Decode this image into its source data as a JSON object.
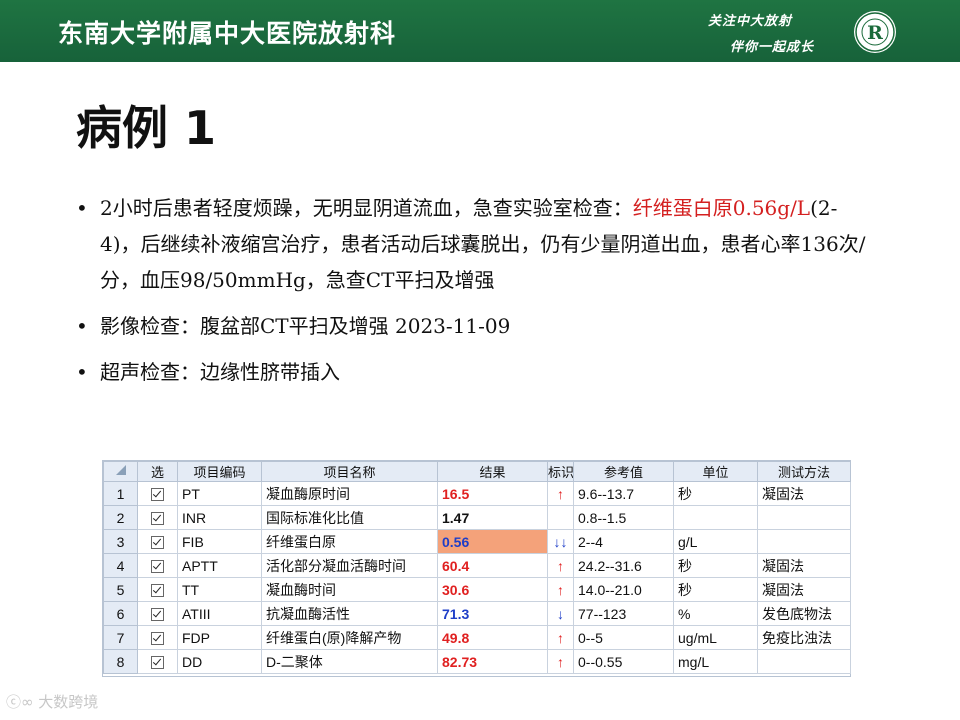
{
  "header": {
    "title": "东南大学附属中大医院放射科",
    "slogan_line1": "关注中大放射",
    "slogan_line2": "伴你一起成长",
    "logo_letter": "R",
    "color": "#1a6a3a"
  },
  "slide": {
    "title": "病例 1",
    "bullets": [
      {
        "parts": [
          {
            "text": "2小时后患者轻度烦躁，无明显阴道流血，急查实验室检查：",
            "color": "#111111"
          },
          {
            "text": "纤维蛋白原0.56g/L",
            "color": "#d42020"
          },
          {
            "text": "(2-4)，后继续补液缩宫治疗，患者活动后球囊脱出，仍有少量阴道出血，患者心率136次/分，血压98/50mmHg，急查CT平扫及增强",
            "color": "#111111"
          }
        ]
      },
      {
        "parts": [
          {
            "text": "影像检查：腹盆部CT平扫及增强 2023-11-09",
            "color": "#111111"
          }
        ]
      },
      {
        "parts": [
          {
            "text": "超声检查：边缘性脐带插入",
            "color": "#111111"
          }
        ]
      }
    ]
  },
  "lab_table": {
    "headers": [
      "",
      "选",
      "项目编码",
      "项目名称",
      "结果",
      "标识",
      "参考值",
      "单位",
      "测试方法"
    ],
    "rows": [
      {
        "idx": "1",
        "code": "PT",
        "name": "凝血酶原时间",
        "result": "16.5",
        "status": "high",
        "flag": "↑",
        "ref": "9.6--13.7",
        "unit": "秒",
        "method": "凝固法"
      },
      {
        "idx": "2",
        "code": "INR",
        "name": "国际标准化比值",
        "result": "1.47",
        "status": "normal",
        "flag": "",
        "ref": "0.8--1.5",
        "unit": "",
        "method": ""
      },
      {
        "idx": "3",
        "code": "FIB",
        "name": "纤维蛋白原",
        "result": "0.56",
        "status": "critical-low",
        "flag": "↓↓",
        "ref": "2--4",
        "unit": "g/L",
        "method": ""
      },
      {
        "idx": "4",
        "code": "APTT",
        "name": "活化部分凝血活酶时间",
        "result": "60.4",
        "status": "high",
        "flag": "↑",
        "ref": "24.2--31.6",
        "unit": "秒",
        "method": "凝固法"
      },
      {
        "idx": "5",
        "code": "TT",
        "name": "凝血酶时间",
        "result": "30.6",
        "status": "high",
        "flag": "↑",
        "ref": "14.0--21.0",
        "unit": "秒",
        "method": "凝固法"
      },
      {
        "idx": "6",
        "code": "ATIII",
        "name": "抗凝血酶活性",
        "result": "71.3",
        "status": "low",
        "flag": "↓",
        "ref": "77--123",
        "unit": "%",
        "method": "发色底物法"
      },
      {
        "idx": "7",
        "code": "FDP",
        "name": "纤维蛋白(原)降解产物",
        "result": "49.8",
        "status": "high",
        "flag": "↑",
        "ref": "0--5",
        "unit": "ug/mL",
        "method": "免疫比浊法"
      },
      {
        "idx": "8",
        "code": "DD",
        "name": "D-二聚体",
        "result": "82.73",
        "status": "high",
        "flag": "↑",
        "ref": "0--0.55",
        "unit": "mg/L",
        "method": ""
      }
    ],
    "colors": {
      "high": "#e02020",
      "low": "#1e3ec8",
      "highlight": "#f4a27a"
    }
  },
  "watermark": {
    "text": "大数跨境"
  }
}
